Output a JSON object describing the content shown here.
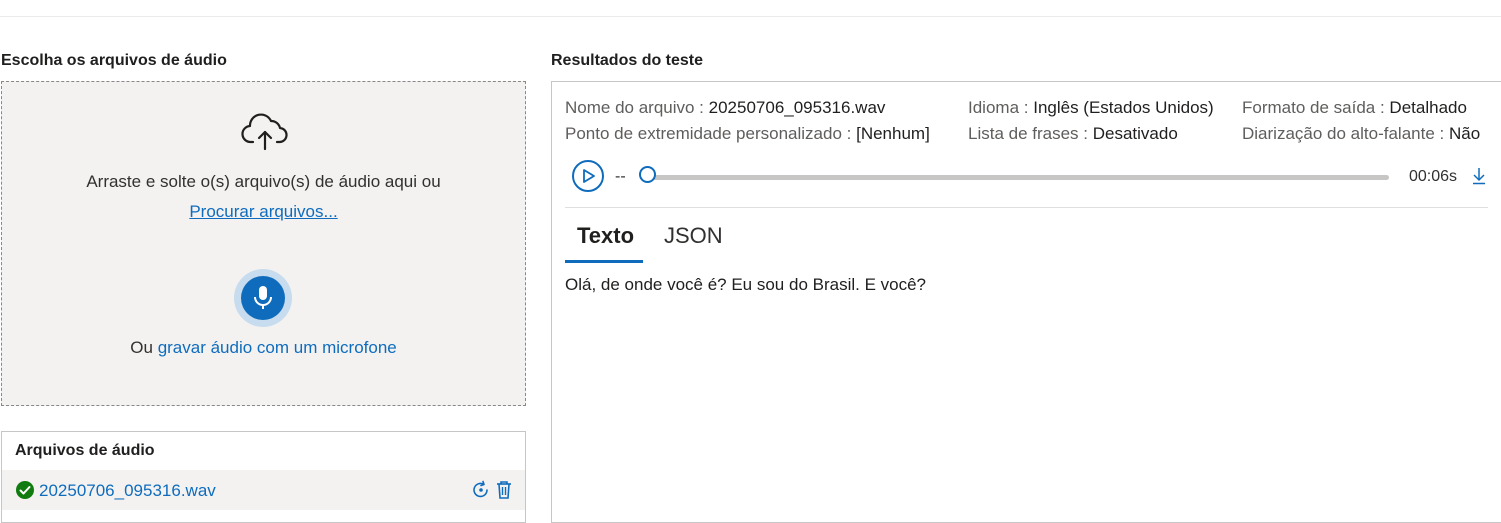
{
  "left": {
    "title": "Escolha os arquivos de áudio",
    "drop_text": "Arraste e solte o(s) arquivo(s) de áudio aqui ou",
    "browse_link": "Procurar arquivos...",
    "mic_prefix": "Ou",
    "mic_link": "gravar áudio com um microfone"
  },
  "files": {
    "title": "Arquivos de áudio",
    "items": [
      {
        "name": "20250706_095316.wav",
        "status": "success"
      }
    ]
  },
  "results": {
    "title": "Resultados do teste",
    "meta": {
      "file_key": "Nome do arquivo :",
      "file_val": "20250706_095316.wav",
      "endpoint_key": "Ponto de extremidade personalizado :",
      "endpoint_val": "[Nenhum]",
      "lang_key": "Idioma :",
      "lang_val": "Inglês (Estados Unidos)",
      "phrase_key": "Lista de frases :",
      "phrase_val": "Desativado",
      "format_key": "Formato de saída :",
      "format_val": "Detalhado",
      "diar_key": "Diarização do alto-falante :",
      "diar_val": "Não"
    },
    "player": {
      "current": "--",
      "total": "00:06s",
      "progress": 0
    },
    "tabs": [
      {
        "label": "Texto",
        "active": true
      },
      {
        "label": "JSON",
        "active": false
      }
    ],
    "text": "Olá, de onde você é? Eu sou do Brasil. E você?"
  },
  "colors": {
    "accent": "#0f6cbd",
    "success": "#107c10",
    "dropzone_bg": "#f3f2f1"
  },
  "icons": [
    "cloud-upload-icon",
    "microphone-icon",
    "check-circle-icon",
    "retry-icon",
    "trash-icon",
    "play-icon",
    "download-icon"
  ]
}
